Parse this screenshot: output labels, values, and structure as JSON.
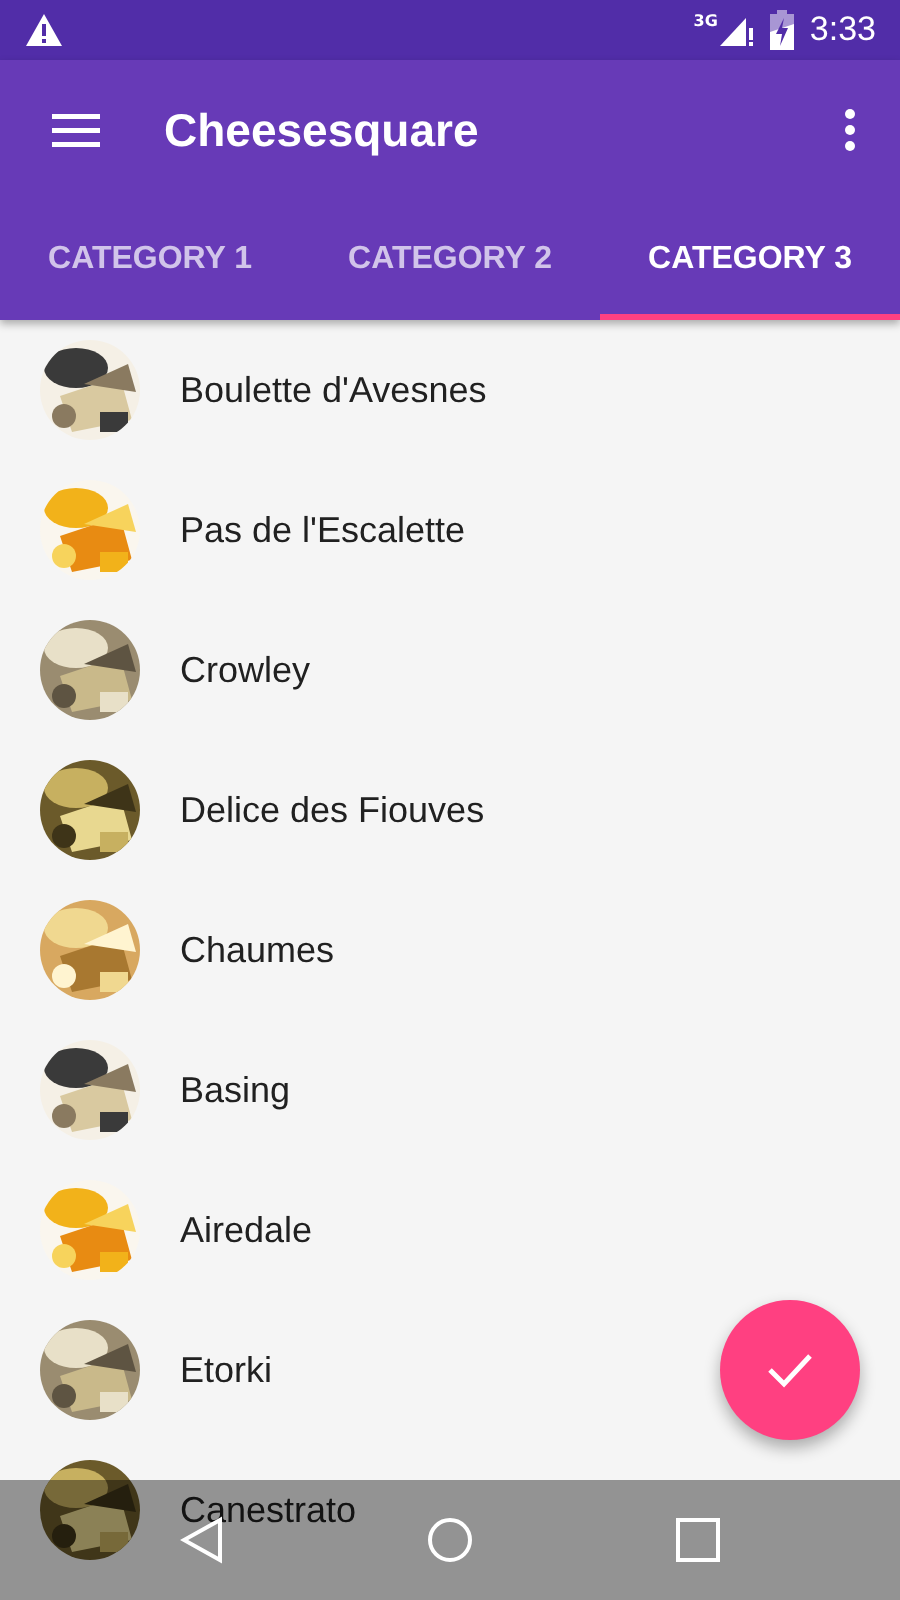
{
  "status_bar": {
    "network": "3G",
    "time": "3:33"
  },
  "toolbar": {
    "title": "Cheesesquare"
  },
  "tabs": [
    {
      "label": "CATEGORY 1",
      "selected": false
    },
    {
      "label": "CATEGORY 2",
      "selected": false
    },
    {
      "label": "CATEGORY 3",
      "selected": true
    }
  ],
  "list": [
    {
      "name": "Boulette d'Avesnes"
    },
    {
      "name": "Pas de l'Escalette"
    },
    {
      "name": "Crowley"
    },
    {
      "name": "Delice des Fiouves"
    },
    {
      "name": "Chaumes"
    },
    {
      "name": "Basing"
    },
    {
      "name": "Airedale"
    },
    {
      "name": "Etorki"
    },
    {
      "name": "Canestrato"
    }
  ]
}
